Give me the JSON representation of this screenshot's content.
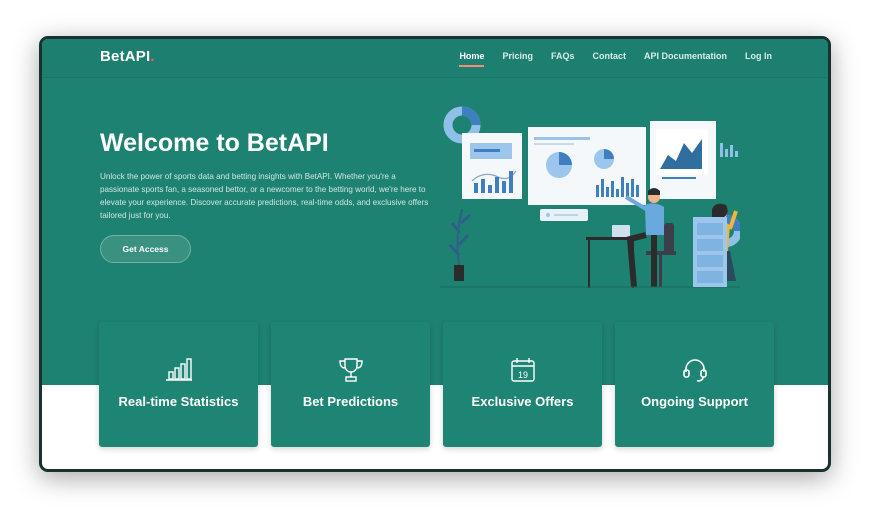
{
  "brand": {
    "name": "BetAPI",
    "dot": "."
  },
  "nav": {
    "items": [
      {
        "label": "Home",
        "active": true
      },
      {
        "label": "Pricing"
      },
      {
        "label": "FAQs"
      },
      {
        "label": "Contact"
      },
      {
        "label": "API Documentation"
      },
      {
        "label": "Log In"
      }
    ]
  },
  "hero": {
    "title": "Welcome to BetAPI",
    "description": "Unlock the power of sports data and betting insights with BetAPI. Whether you're a passionate sports fan, a seasoned bettor, or a newcomer to the betting world, we're here to elevate your experience. Discover accurate predictions, real-time odds, and exclusive offers tailored just for you.",
    "cta_label": "Get Access"
  },
  "features": [
    {
      "title": "Real-time Statistics",
      "icon": "bar-chart-icon"
    },
    {
      "title": "Bet Predictions",
      "icon": "trophy-icon"
    },
    {
      "title": "Exclusive Offers",
      "icon": "calendar-icon",
      "icon_text": "19"
    },
    {
      "title": "Ongoing Support",
      "icon": "headset-icon"
    }
  ],
  "colors": {
    "primary": "#1e8272",
    "card": "#1e8473",
    "accent": "#ff5a5a",
    "frame": "#16332f"
  }
}
